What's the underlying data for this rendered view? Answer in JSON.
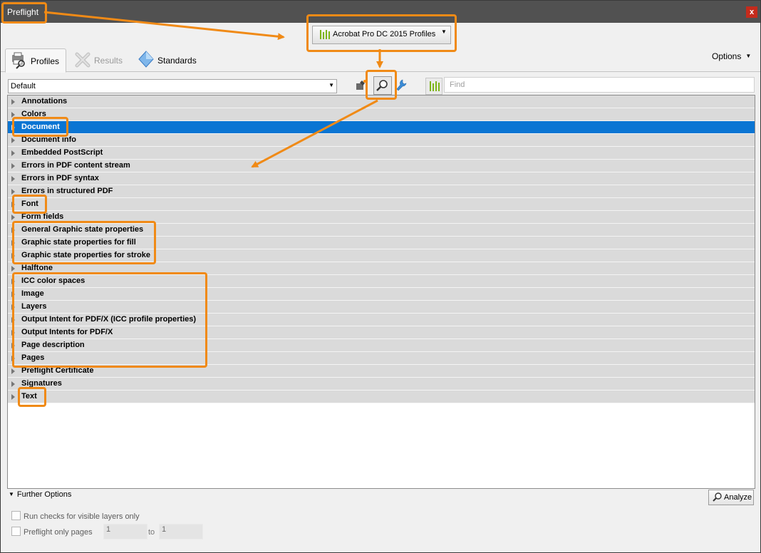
{
  "window": {
    "title": "Preflight",
    "close_label": "x"
  },
  "profile_library": {
    "label": "Acrobat Pro DC 2015 Profiles",
    "caret": "▼"
  },
  "tabs": [
    {
      "label": "Profiles",
      "active": true
    },
    {
      "label": "Results",
      "active": false
    },
    {
      "label": "Standards",
      "active": false
    }
  ],
  "options": {
    "label": "Options",
    "caret": "▼"
  },
  "toolbar": {
    "profile_select_value": "Default",
    "select_arrow": "▼",
    "find_placeholder": "Find",
    "icons": [
      "single-fixups-icon",
      "single-checks-icon",
      "fixups-wrench-icon",
      "profiles-bars-icon"
    ]
  },
  "list": {
    "items": [
      "Annotations",
      "Colors",
      "Document",
      "Document info",
      "Embedded PostScript",
      "Errors in PDF content stream",
      "Errors in PDF syntax",
      "Errors in structured PDF",
      "Font",
      "Form fields",
      "General Graphic state properties",
      "Graphic state properties for fill",
      "Graphic state properties for stroke",
      "Halftone",
      "ICC color spaces",
      "Image",
      "Layers",
      "Output Intent for PDF/X (ICC profile properties)",
      "Output Intents for PDF/X",
      "Page description",
      "Pages",
      "Preflight Certificate",
      "Signatures",
      "Text"
    ],
    "selected_index": 2
  },
  "further_options": {
    "label": "Further Options",
    "arrow": "▼"
  },
  "analyze": {
    "label": "Analyze"
  },
  "checks": {
    "visible_layers": "Run checks for visible layers only",
    "only_pages": "Preflight only pages"
  },
  "page_range": {
    "from": "1",
    "to_label": "to",
    "to": "1"
  },
  "colors": {
    "accent": "#f08a16",
    "selection": "#0a75d3",
    "titlebar": "#515151",
    "row_bg": "#dadada",
    "bars_icon": "#7cb518"
  }
}
